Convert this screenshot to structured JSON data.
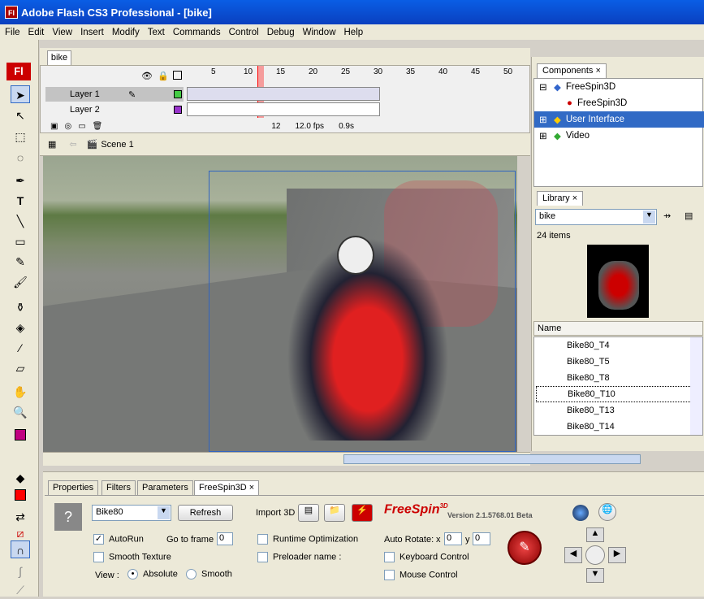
{
  "window": {
    "title": "Adobe Flash CS3 Professional - [bike]",
    "app_icon": "Fl"
  },
  "menu": [
    "File",
    "Edit",
    "View",
    "Insert",
    "Modify",
    "Text",
    "Commands",
    "Control",
    "Debug",
    "Window",
    "Help"
  ],
  "document": {
    "tab": "bike"
  },
  "timeline": {
    "layers": [
      {
        "name": "Layer 1"
      },
      {
        "name": "Layer 2"
      }
    ],
    "frame_numbers": [
      "5",
      "10",
      "15",
      "20",
      "25",
      "30",
      "35",
      "40",
      "45",
      "50"
    ],
    "current_frame": "12",
    "fps": "12.0 fps",
    "time": "0.9s"
  },
  "stagebar": {
    "scene": "Scene 1"
  },
  "components_panel": {
    "tab": "Components",
    "items": [
      {
        "label": "FreeSpin3D"
      },
      {
        "label": "FreeSpin3D"
      },
      {
        "label": "User Interface"
      },
      {
        "label": "Video"
      }
    ]
  },
  "library_panel": {
    "tab": "Library",
    "selected": "bike",
    "count": "24 items",
    "column": "Name",
    "items": [
      "Bike80_T4",
      "Bike80_T5",
      "Bike80_T8",
      "Bike80_T10",
      "Bike80_T13",
      "Bike80_T14"
    ]
  },
  "properties": {
    "tabs": [
      "Properties",
      "Filters",
      "Parameters",
      "FreeSpin3D"
    ],
    "model": "Bike80",
    "refresh": "Refresh",
    "import3d": "Import 3D",
    "brand": "FreeSpin",
    "brand_sup": "3D",
    "version": "Version 2.1.5768.01 Beta",
    "autorun": "AutoRun",
    "goto_frame": "Go to frame",
    "goto_value": "0",
    "smooth_texture": "Smooth Texture",
    "view_label": "View :",
    "absolute": "Absolute",
    "smooth": "Smooth",
    "runtime_opt": "Runtime Optimization",
    "preloader": "Preloader name :",
    "auto_rotate": "Auto Rotate:",
    "x_label": "x",
    "x_value": "0",
    "y_label": "y",
    "y_value": "0",
    "keyboard": "Keyboard Control",
    "mouse": "Mouse Control"
  }
}
